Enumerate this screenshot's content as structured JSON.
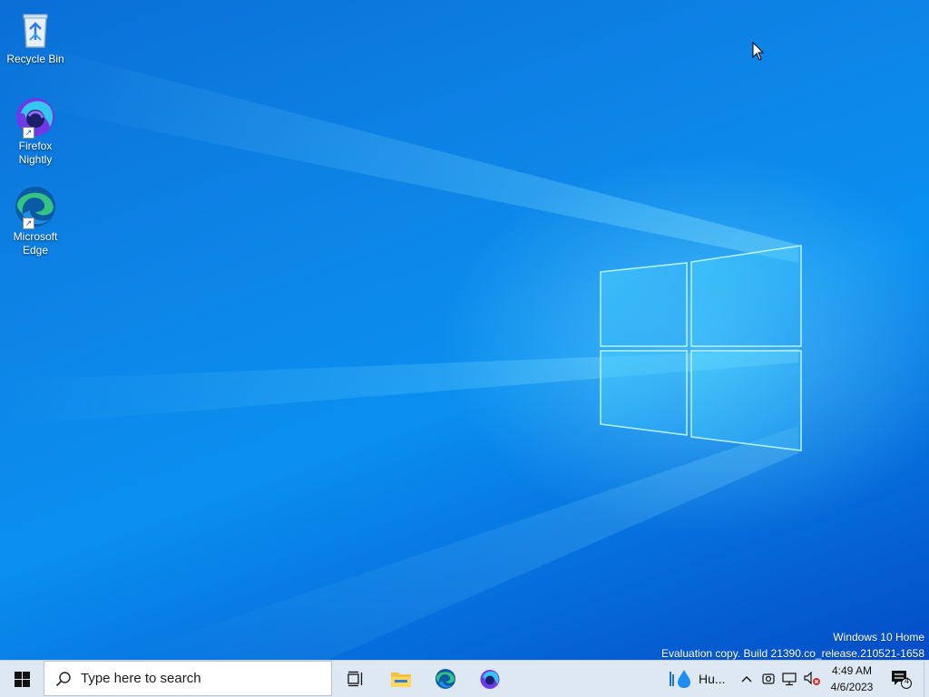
{
  "desktop": {
    "icons": [
      {
        "label": "Recycle Bin"
      },
      {
        "label": "Firefox\nNightly"
      },
      {
        "label": "Microsoft\nEdge"
      }
    ],
    "watermark": {
      "line1": "Windows 10 Home",
      "line2": "Evaluation copy. Build 21390.co_release.210521-1658"
    }
  },
  "taskbar": {
    "search_placeholder": "Type here to search",
    "weather_text": "Hu...",
    "clock_time": "4:49 AM",
    "clock_date": "4/6/2023",
    "notification_count": "4",
    "pinned": [
      "task-view",
      "file-explorer",
      "microsoft-edge",
      "firefox-nightly"
    ]
  },
  "colors": {
    "taskbar_bg": "#dde8f2",
    "desktop_accent": "#0a8ff0"
  }
}
